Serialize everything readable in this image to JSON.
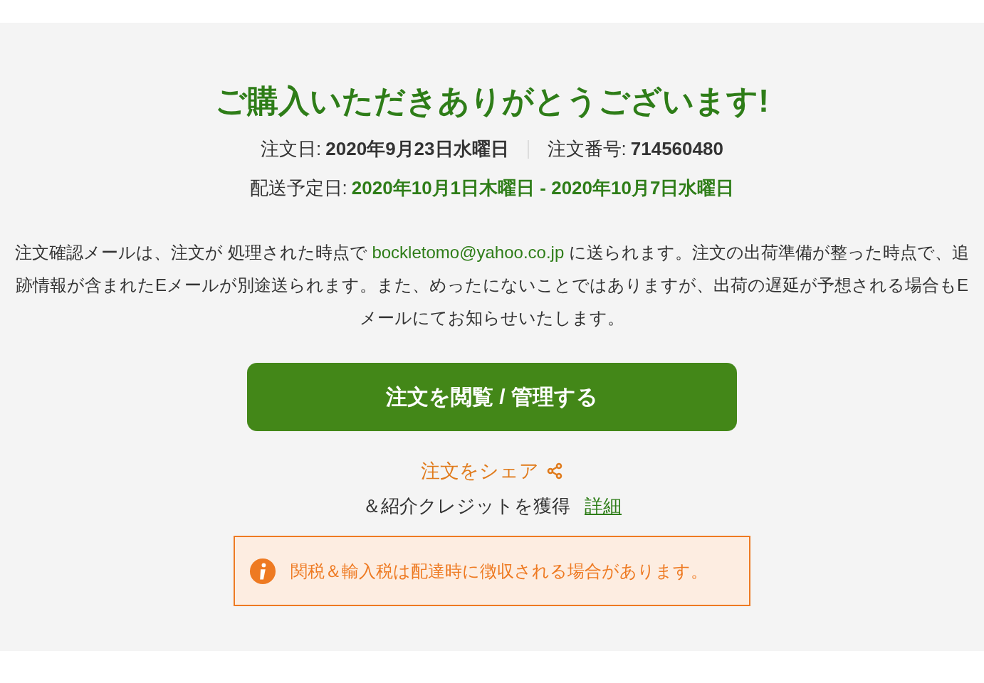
{
  "title": "ご購入いただきありがとうございます!",
  "order_date": {
    "label": "注文日:",
    "value": "2020年9月23日水曜日"
  },
  "order_number": {
    "label": "注文番号:",
    "value": "714560480"
  },
  "delivery": {
    "label": "配送予定日:",
    "value": "2020年10月1日木曜日 - 2020年10月7日水曜日"
  },
  "message": {
    "before": "注文確認メールは、注文が 処理された時点で",
    "email": "bockletomo@yahoo.co.jp",
    "after": "に送られます。注文の出荷準備が整った時点で、追跡情報が含まれたEメールが別途送られます。また、めったにないことではありますが、出荷の遅延が予想される場合もEメールにてお知らせいたします。"
  },
  "primary_button": "注文を閲覧 / 管理する",
  "share": {
    "label": "注文をシェア",
    "credit": "＆紹介クレジットを獲得",
    "details_link": "詳細"
  },
  "notice": {
    "text": "関税＆輸入税は配達時に徴収される場合があります。"
  }
}
